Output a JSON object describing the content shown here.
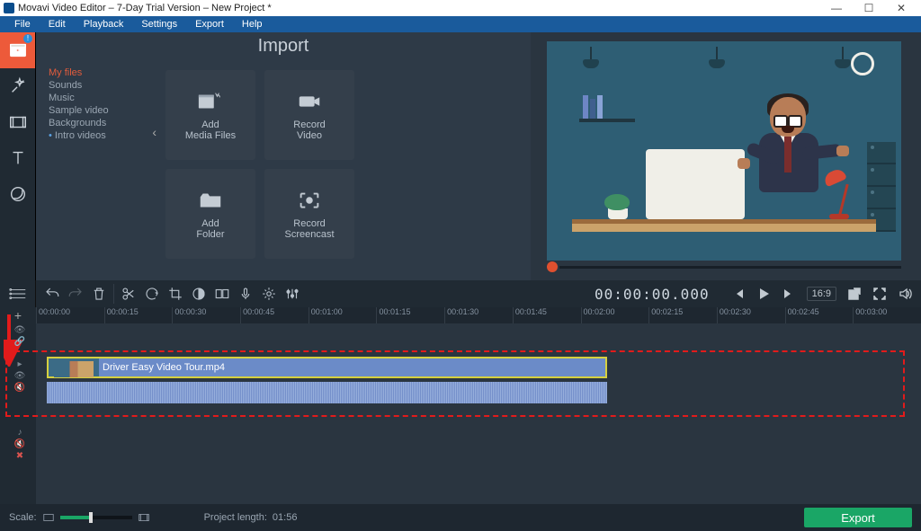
{
  "window": {
    "title": "Movavi Video Editor – 7-Day Trial Version – New Project *"
  },
  "menu": {
    "file": "File",
    "edit": "Edit",
    "playback": "Playback",
    "settings": "Settings",
    "export": "Export",
    "help": "Help"
  },
  "import": {
    "title": "Import",
    "cats": {
      "myfiles": "My files",
      "sounds": "Sounds",
      "music": "Music",
      "sample": "Sample video",
      "bg": "Backgrounds",
      "intro": "Intro videos"
    },
    "tiles": {
      "addmedia": "Add\nMedia Files",
      "recvideo": "Record\nVideo",
      "addfolder": "Add\nFolder",
      "recscreen": "Record\nScreencast"
    }
  },
  "preview": {
    "timecode": "00:00:00.000",
    "aspect": "16:9"
  },
  "ruler": [
    "00:00:00",
    "00:00:15",
    "00:00:30",
    "00:00:45",
    "00:01:00",
    "00:01:15",
    "00:01:30",
    "00:01:45",
    "00:02:00",
    "00:02:15",
    "00:02:30",
    "00:02:45",
    "00:03:00"
  ],
  "clip": {
    "name": "Driver Easy Video Tour.mp4"
  },
  "status": {
    "scale": "Scale:",
    "projlen_label": "Project length:",
    "projlen": "01:56",
    "export": "Export"
  },
  "help": "?"
}
